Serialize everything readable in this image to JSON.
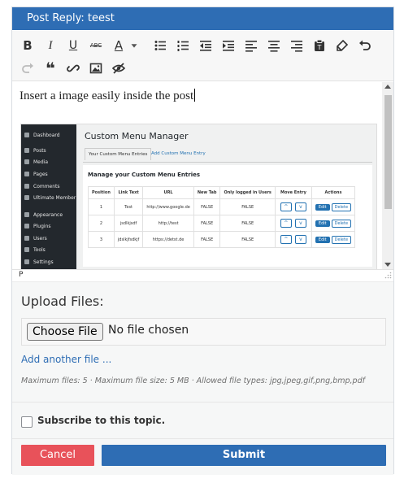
{
  "header": {
    "title": "Post Reply: teest"
  },
  "toolbar": {
    "row1": [
      "bold-icon",
      "italic-icon",
      "underline-icon",
      "strikethrough-icon",
      "text-color-icon",
      "color-dropdown-icon",
      "bullet-list-icon",
      "numbered-list-icon",
      "outdent-icon",
      "indent-icon",
      "align-left-icon",
      "align-center-icon",
      "align-right-icon",
      "paste-text-icon",
      "clear-formatting-icon",
      "undo-icon"
    ],
    "row2": [
      "redo-icon",
      "blockquote-icon",
      "link-icon",
      "image-icon",
      "hide-preview-icon"
    ],
    "bold_label": "B",
    "italic_label": "I",
    "underline_label": "U",
    "strike_label": "ABC",
    "textcolor_label": "A",
    "quote_label": "❝"
  },
  "editor": {
    "text": "Insert a image easily inside the post",
    "status_path": "P"
  },
  "embedded_screenshot": {
    "sidebar": [
      "Dashboard",
      "Posts",
      "Media",
      "Pages",
      "Comments",
      "Ultimate Member",
      "Appearance",
      "Plugins",
      "Users",
      "Tools",
      "Settings"
    ],
    "title": "Custom Menu Manager",
    "tabs": [
      "Your Custom Menu Entries",
      "Add Custom Menu Entry"
    ],
    "card_title": "Manage your Custom Menu Entries",
    "columns": [
      "Position",
      "Link Text",
      "URL",
      "New Tab",
      "Only logged in Users",
      "Move Entry",
      "Actions"
    ],
    "rows": [
      [
        "1",
        "Test",
        "http://www.google.de",
        "FALSE",
        "FALSE"
      ],
      [
        "2",
        "jsdlkjsdf",
        "http://test",
        "FALSE",
        "FALSE"
      ],
      [
        "3",
        "jdslkjfsdkjf",
        "https://detst.de",
        "FALSE",
        "FALSE"
      ]
    ],
    "edit_label": "Edit",
    "delete_label": "Delete"
  },
  "upload": {
    "title": "Upload Files:",
    "choose_label": "Choose File",
    "no_file": "No file chosen",
    "add_another": "Add another file ...",
    "limits": "Maximum files: 5 · Maximum file size: 5 MB · Allowed file types: jpg,jpeg,gif,png,bmp,pdf"
  },
  "subscribe": {
    "label": "Subscribe to this topic.",
    "checked": false
  },
  "actions": {
    "cancel": "Cancel",
    "submit": "Submit"
  },
  "colors": {
    "accent": "#2e6db4",
    "cancel": "#e8525a"
  }
}
